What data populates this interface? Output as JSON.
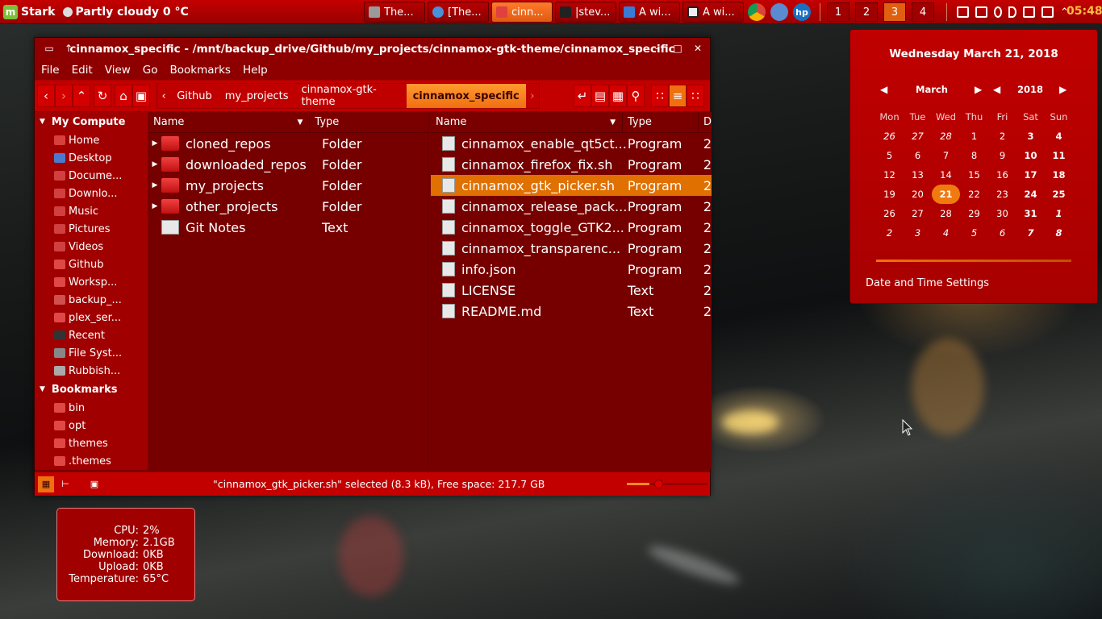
{
  "panel": {
    "menu_label": "Stark",
    "weather": "Partly cloudy 0 °C",
    "tasks": [
      {
        "label": "The...",
        "color": "#9a9a9a"
      },
      {
        "label": "[The...",
        "color": "#4a90d9"
      },
      {
        "label": "cinn...",
        "color": "#e04040"
      },
      {
        "label": "|stev...",
        "color": "#222222"
      },
      {
        "label": "A wi...",
        "color": "#3a7bd5"
      },
      {
        "label": "A wi...",
        "color": "#eeeeee"
      }
    ],
    "workspaces": [
      "1",
      "2",
      "3",
      "4"
    ],
    "clock": "05:48"
  },
  "window": {
    "title": "cinnamox_specific - /mnt/backup_drive/Github/my_projects/cinnamox-gtk-theme/cinnamox_specific",
    "menus": [
      "File",
      "Edit",
      "View",
      "Go",
      "Bookmarks",
      "Help"
    ],
    "breadcrumbs": [
      "Github",
      "my_projects",
      "cinnamox-gtk-theme",
      "cinnamox_specific"
    ],
    "sidebar": {
      "computer_heading": "My Compute",
      "computer_items": [
        {
          "label": "Home",
          "icon": "home-icon"
        },
        {
          "label": "Desktop",
          "icon": "desktop-icon"
        },
        {
          "label": "Docume...",
          "icon": "documents-icon"
        },
        {
          "label": "Downlo...",
          "icon": "downloads-icon"
        },
        {
          "label": "Music",
          "icon": "music-icon"
        },
        {
          "label": "Pictures",
          "icon": "pictures-icon"
        },
        {
          "label": "Videos",
          "icon": "videos-icon"
        },
        {
          "label": "Github",
          "icon": "folder-icon"
        },
        {
          "label": "Worksp...",
          "icon": "folder-icon"
        },
        {
          "label": "backup_...",
          "icon": "drive-icon"
        },
        {
          "label": "plex_ser...",
          "icon": "folder-icon"
        },
        {
          "label": "Recent",
          "icon": "recent-icon"
        },
        {
          "label": "File Syst...",
          "icon": "filesystem-icon"
        },
        {
          "label": "Rubbish...",
          "icon": "trash-icon"
        }
      ],
      "bookmarks_heading": "Bookmarks",
      "bookmark_items": [
        {
          "label": "bin"
        },
        {
          "label": "opt"
        },
        {
          "label": "themes"
        },
        {
          "label": ".themes"
        }
      ]
    },
    "left_pane": {
      "headers": [
        "Name",
        "Type"
      ],
      "rows": [
        {
          "name": "cloned_repos",
          "type": "Folder",
          "kind": "folder"
        },
        {
          "name": "downloaded_repos",
          "type": "Folder",
          "kind": "folder"
        },
        {
          "name": "my_projects",
          "type": "Folder",
          "kind": "folder"
        },
        {
          "name": "other_projects",
          "type": "Folder",
          "kind": "folder"
        },
        {
          "name": "Git Notes",
          "type": "Text",
          "kind": "text"
        }
      ]
    },
    "right_pane": {
      "headers": [
        "Name",
        "Type",
        "D"
      ],
      "rows": [
        {
          "name": "cinnamox_enable_qt5ct...",
          "type": "Program",
          "extra": "2",
          "kind": "script"
        },
        {
          "name": "cinnamox_firefox_fix.sh",
          "type": "Program",
          "extra": "2",
          "kind": "script"
        },
        {
          "name": "cinnamox_gtk_picker.sh",
          "type": "Program",
          "extra": "2",
          "kind": "script",
          "selected": true
        },
        {
          "name": "cinnamox_release_pack...",
          "type": "Program",
          "extra": "2",
          "kind": "script"
        },
        {
          "name": "cinnamox_toggle_GTK2...",
          "type": "Program",
          "extra": "2",
          "kind": "script"
        },
        {
          "name": "cinnamox_transparenc...",
          "type": "Program",
          "extra": "2",
          "kind": "script"
        },
        {
          "name": "info.json",
          "type": "Program",
          "extra": "2",
          "kind": "script"
        },
        {
          "name": "LICENSE",
          "type": "Text",
          "extra": "2",
          "kind": "text"
        },
        {
          "name": "README.md",
          "type": "Text",
          "extra": "2",
          "kind": "text"
        }
      ]
    },
    "status": "\"cinnamox_gtk_picker.sh\" selected (8.3 kB), Free space: 217.7 GB"
  },
  "calendar": {
    "full_date": "Wednesday March 21, 2018",
    "month": "March",
    "year": "2018",
    "weekdays": [
      "Mon",
      "Tue",
      "Wed",
      "Thu",
      "Fri",
      "Sat",
      "Sun"
    ],
    "weeks": [
      [
        "26",
        "27",
        "28",
        "1",
        "2",
        "3",
        "4"
      ],
      [
        "5",
        "6",
        "7",
        "8",
        "9",
        "10",
        "11"
      ],
      [
        "12",
        "13",
        "14",
        "15",
        "16",
        "17",
        "18"
      ],
      [
        "19",
        "20",
        "21",
        "22",
        "23",
        "24",
        "25"
      ],
      [
        "26",
        "27",
        "28",
        "29",
        "30",
        "31",
        "1"
      ],
      [
        "2",
        "3",
        "4",
        "5",
        "6",
        "7",
        "8"
      ]
    ],
    "today": "21",
    "settings_label": "Date and Time Settings"
  },
  "sysmon": {
    "rows": [
      {
        "key": "CPU:",
        "value": "2%"
      },
      {
        "key": "Memory:",
        "value": "2.1GB"
      },
      {
        "key": "Download:",
        "value": "0KB"
      },
      {
        "key": "Upload:",
        "value": "0KB"
      },
      {
        "key": "Temperature:",
        "value": "65°C"
      }
    ]
  }
}
